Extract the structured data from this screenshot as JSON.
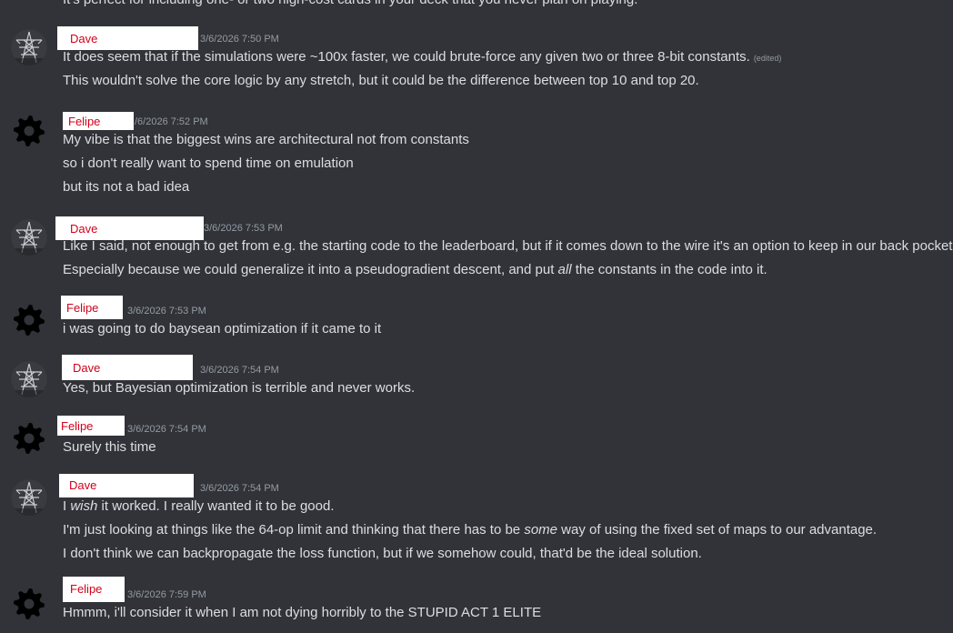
{
  "top_cut_text": "It's perfect for including one- or two high-cost cards in your deck that you never plan on playing.",
  "messages": [
    {
      "author": "Dave",
      "timestamp": "3/6/2026 7:50 PM",
      "avatar_icon": "steel-tower-avatar",
      "lines": [
        "It does seem that if the simulations were ~100x faster, we could brute-force any given two or three 8-bit constants.",
        "This wouldn't solve the core logic by any stretch, but it could be the difference between top 10 and top 20."
      ],
      "edited_label": "(edited)"
    },
    {
      "author": "Felipe",
      "timestamp": "/6/2026 7:52 PM",
      "avatar_icon": "gear-icon",
      "lines": [
        "My vibe is that the biggest wins are architectural not from constants",
        "so i don't really want to spend time on emulation",
        "but its not a bad idea"
      ]
    },
    {
      "author": "Dave",
      "timestamp": "3/6/2026 7:53 PM",
      "avatar_icon": "steel-tower-avatar",
      "lines": [
        "Like I said, not enough to get from e.g. the starting code to the leaderboard, but if it comes down to the wire it's an option to keep in our back pocket.",
        {
          "before": "Especially because we could generalize it into a pseudogradient descent, and put ",
          "em": "all",
          "after": " the constants in the code into it."
        }
      ]
    },
    {
      "author": "Felipe",
      "timestamp": "3/6/2026 7:53 PM",
      "avatar_icon": "gear-icon",
      "lines": [
        "i was going to do baysean optimization if it came to it"
      ]
    },
    {
      "author": "Dave",
      "timestamp": "3/6/2026 7:54 PM",
      "avatar_icon": "steel-tower-avatar",
      "lines": [
        "Yes, but Bayesian optimization is terrible and never works."
      ]
    },
    {
      "author": "Felipe",
      "timestamp": "3/6/2026 7:54 PM",
      "avatar_icon": "gear-icon",
      "lines": [
        "Surely this time"
      ]
    },
    {
      "author": "Dave",
      "timestamp": "3/6/2026 7:54 PM",
      "avatar_icon": "steel-tower-avatar",
      "lines": [
        {
          "before": "I ",
          "em": "wish",
          "after": " it worked.  I really wanted it to be good."
        },
        {
          "before": "I'm just looking at things like the 64-op limit and thinking that there has to be ",
          "em": "some",
          "after": " way of using the fixed set of maps to our advantage."
        },
        "I don't think we can backpropagate the loss function, but if we somehow could, that'd be the ideal solution."
      ]
    },
    {
      "author": "Felipe",
      "timestamp": "3/6/2026 7:59 PM",
      "avatar_icon": "gear-icon",
      "lines": [
        "Hmmm, i'll consider it when I am not dying horribly to the STUPID ACT 1 ELITE"
      ]
    }
  ]
}
